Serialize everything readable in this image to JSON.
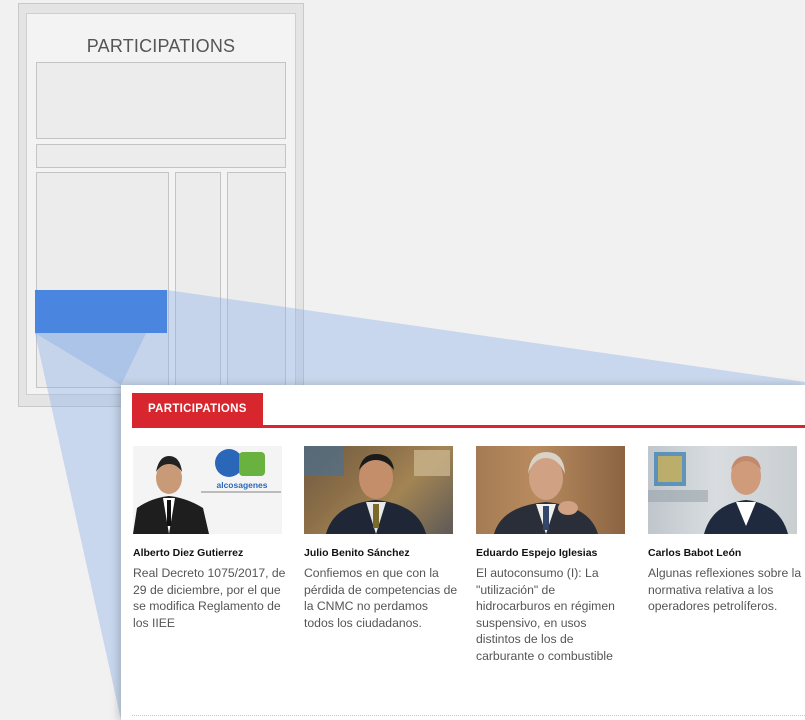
{
  "mockup": {
    "title": "PARTICIPATIONS"
  },
  "panel": {
    "tab_label": "PARTICIPATIONS",
    "accent_color": "#d7262e",
    "cards": [
      {
        "author": "Alberto Diez Gutierrez",
        "article": "Real Decreto 1075/2017, de 29 de diciembre, por el que se modifica Reglamento de los IIEE",
        "logo_text": "alcosagenes"
      },
      {
        "author": "Julio Benito Sánchez",
        "article": "Confiemos en que con la pérdida de competencias de la CNMC no perdamos todos los ciudadanos."
      },
      {
        "author": "Eduardo Espejo Iglesias",
        "article": "El autoconsumo (I): La \"utilización\" de hidrocarburos en régimen suspensivo, en usos distintos de los de carburante o combustible"
      },
      {
        "author": "Carlos Babot León",
        "article": "Algunas reflexiones sobre la normativa relativa a los operadores petrolíferos."
      }
    ]
  }
}
